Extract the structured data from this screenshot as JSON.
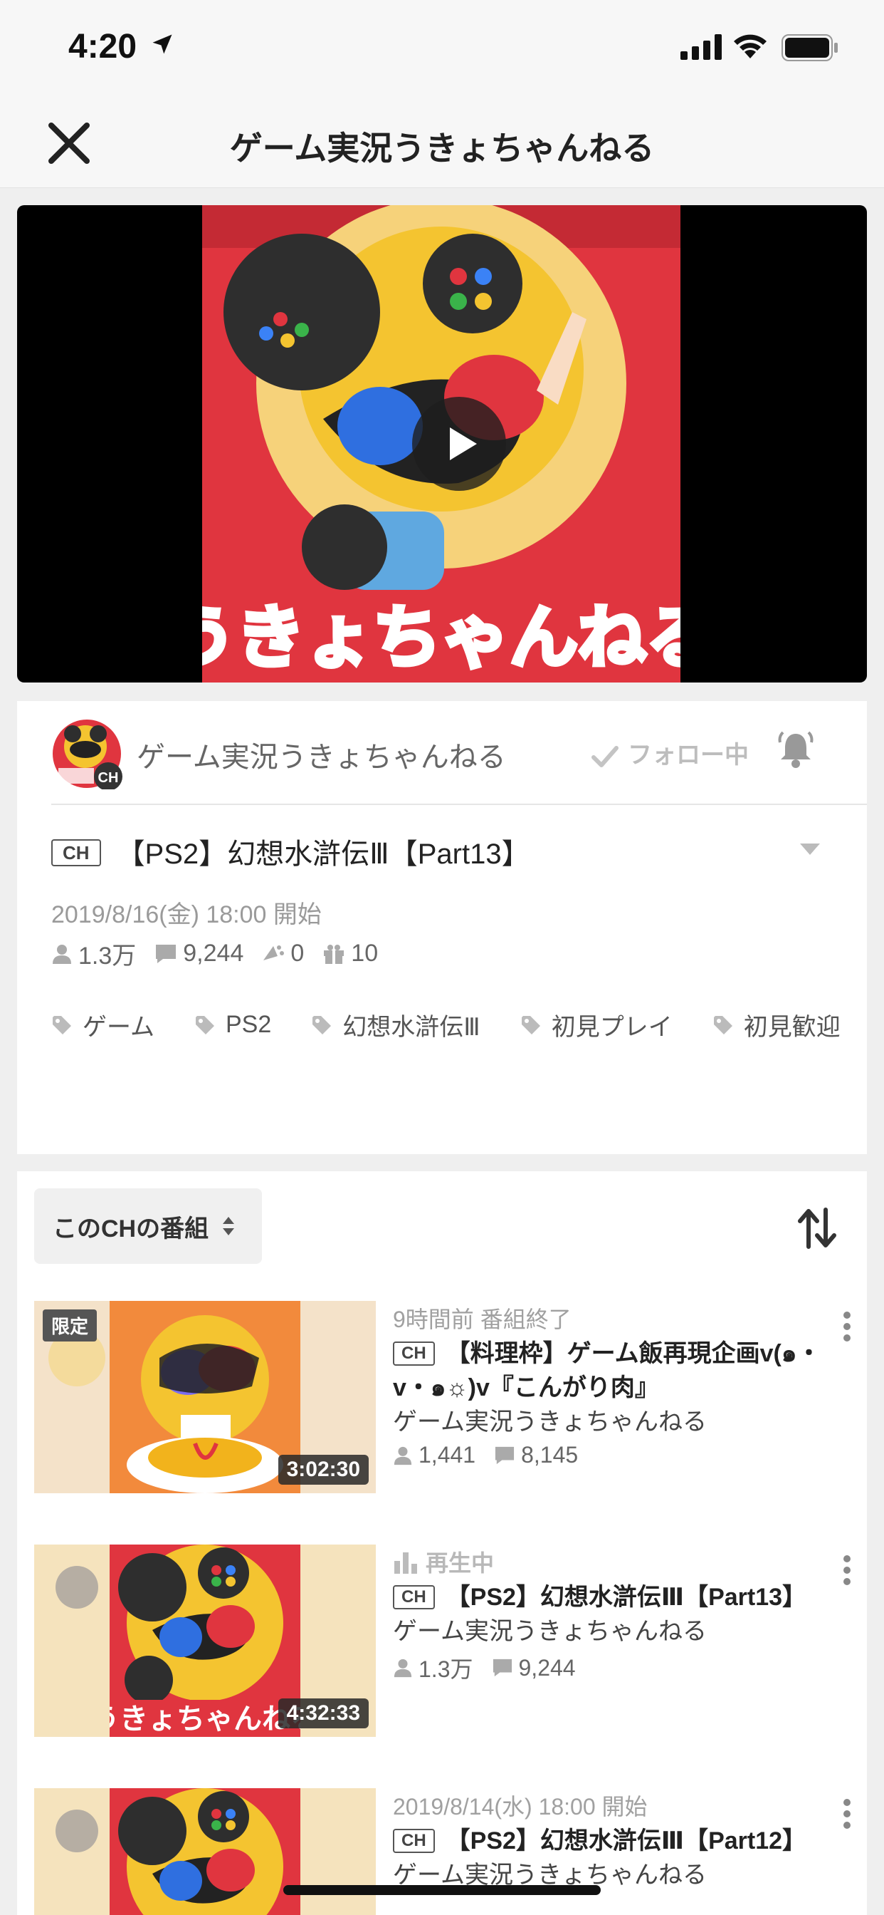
{
  "status_bar": {
    "time": "4:20"
  },
  "nav": {
    "title": "ゲーム実況うきょちゃんねる"
  },
  "player": {
    "art_text": "うきょちゃんねる"
  },
  "program": {
    "channel_name": "ゲーム実況うきょちゃんねる",
    "avatar_badge": "CH",
    "follow_label": "フォロー中",
    "ch_badge": "CH",
    "title": "【PS2】幻想水滸伝Ⅲ【Part13】",
    "start": "2019/8/16(金) 18:00 開始",
    "stats": {
      "viewers": "1.3万",
      "comments": "9,244",
      "ads": "0",
      "gifts": "10"
    },
    "tags": [
      "ゲーム",
      "PS2",
      "幻想水滸伝Ⅲ",
      "初見プレイ",
      "初見歓迎"
    ]
  },
  "list": {
    "sort_label": "このCHの番組",
    "items": [
      {
        "status": "9時間前 番組終了",
        "ch_badge": "CH",
        "title": "【料理枠】ゲーム飯再現企画v(๑・v・๑☼)v『こんがり肉』",
        "channel": "ゲーム実況うきょちゃんねる",
        "viewers": "1,441",
        "comments": "8,145",
        "duration": "3:02:30",
        "limited": "限定"
      },
      {
        "status": "再生中",
        "ch_badge": "CH",
        "title": "【PS2】幻想水滸伝Ⅲ【Part13】",
        "channel": "ゲーム実況うきょちゃんねる",
        "viewers": "1.3万",
        "comments": "9,244",
        "duration": "4:32:33"
      },
      {
        "status": "2019/8/14(水) 18:00 開始",
        "ch_badge": "CH",
        "title": "【PS2】幻想水滸伝Ⅲ【Part12】",
        "channel": "ゲーム実況うきょちゃんねる"
      }
    ]
  },
  "colors": {
    "accent_red": "#e0353f",
    "art_yellow": "#f4c430",
    "gray_text": "#9a9a9a"
  }
}
